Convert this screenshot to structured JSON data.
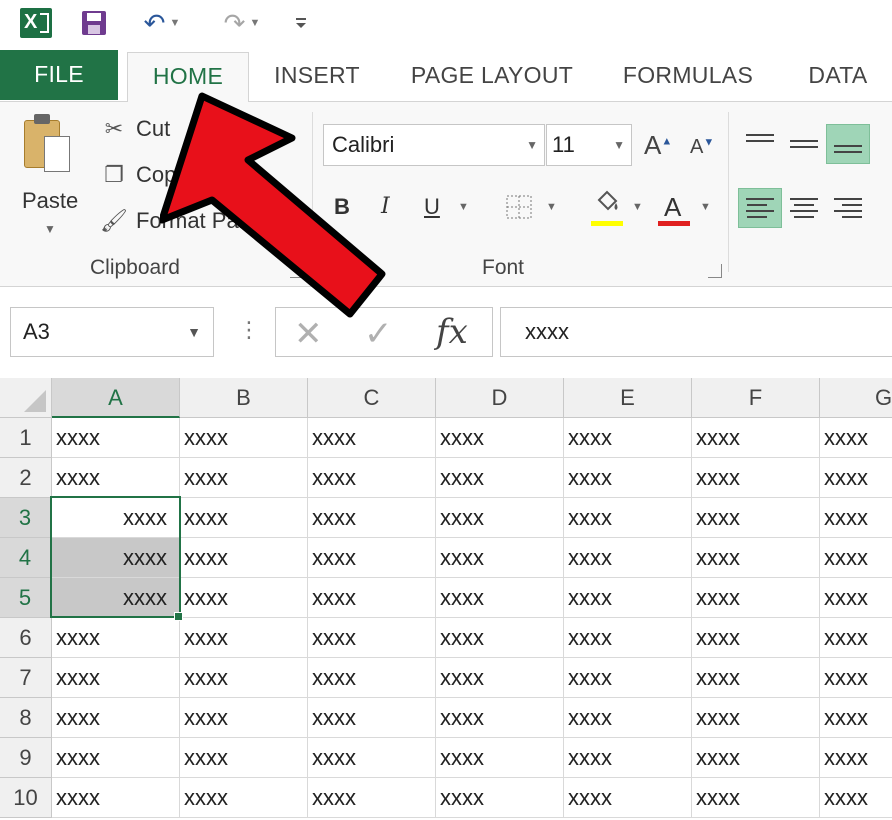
{
  "qat": {
    "app_icon": "excel-logo-icon",
    "app_letter": "X",
    "save_icon": "save-icon",
    "undo_icon": "undo-icon",
    "redo_icon": "redo-icon",
    "customize_icon": "customize-qat-icon"
  },
  "tabs": [
    {
      "label": "FILE"
    },
    {
      "label": "HOME"
    },
    {
      "label": "INSERT"
    },
    {
      "label": "PAGE LAYOUT"
    },
    {
      "label": "FORMULAS"
    },
    {
      "label": "DATA"
    }
  ],
  "ribbon": {
    "clipboard": {
      "group_label": "Clipboard",
      "paste_label": "Paste",
      "cut_label": "Cut",
      "copy_label": "Copy",
      "format_painter_label": "Format Painter"
    },
    "font": {
      "group_label": "Font",
      "font_name": "Calibri",
      "font_size": "11",
      "bold": "B",
      "italic": "I",
      "underline": "U",
      "font_color_letter": "A",
      "fill_color": "#ffff00",
      "font_color": "#e02020"
    }
  },
  "formula_bar": {
    "name_box": "A3",
    "formula": "xxxx",
    "fx_label": "fx"
  },
  "grid": {
    "columns": [
      "A",
      "B",
      "C",
      "D",
      "E",
      "F",
      "G"
    ],
    "rows": [
      {
        "num": "1",
        "cells": [
          "xxxx",
          "xxxx",
          "xxxx",
          "xxxx",
          "xxxx",
          "xxxx",
          "xxxx"
        ]
      },
      {
        "num": "2",
        "cells": [
          "xxxx",
          "xxxx",
          "xxxx",
          "xxxx",
          "xxxx",
          "xxxx",
          "xxxx"
        ]
      },
      {
        "num": "3",
        "cells": [
          "xxxx",
          "xxxx",
          "xxxx",
          "xxxx",
          "xxxx",
          "xxxx",
          "xxxx"
        ]
      },
      {
        "num": "4",
        "cells": [
          "xxxx",
          "xxxx",
          "xxxx",
          "xxxx",
          "xxxx",
          "xxxx",
          "xxxx"
        ]
      },
      {
        "num": "5",
        "cells": [
          "xxxx",
          "xxxx",
          "xxxx",
          "xxxx",
          "xxxx",
          "xxxx",
          "xxxx"
        ]
      },
      {
        "num": "6",
        "cells": [
          "xxxx",
          "xxxx",
          "xxxx",
          "xxxx",
          "xxxx",
          "xxxx",
          "xxxx"
        ]
      },
      {
        "num": "7",
        "cells": [
          "xxxx",
          "xxxx",
          "xxxx",
          "xxxx",
          "xxxx",
          "xxxx",
          "xxxx"
        ]
      },
      {
        "num": "8",
        "cells": [
          "xxxx",
          "xxxx",
          "xxxx",
          "xxxx",
          "xxxx",
          "xxxx",
          "xxxx"
        ]
      },
      {
        "num": "9",
        "cells": [
          "xxxx",
          "xxxx",
          "xxxx",
          "xxxx",
          "xxxx",
          "xxxx",
          "xxxx"
        ]
      },
      {
        "num": "10",
        "cells": [
          "xxxx",
          "xxxx",
          "xxxx",
          "xxxx",
          "xxxx",
          "xxxx",
          "xxxx"
        ]
      }
    ],
    "active_cell": "A3",
    "selected_range": "A3:A5",
    "right_aligned_rows": [
      "3",
      "4",
      "5"
    ],
    "accent_color": "#217346"
  },
  "annotation": {
    "arrow_color": "#e8101a",
    "arrow_target": "HOME tab"
  }
}
